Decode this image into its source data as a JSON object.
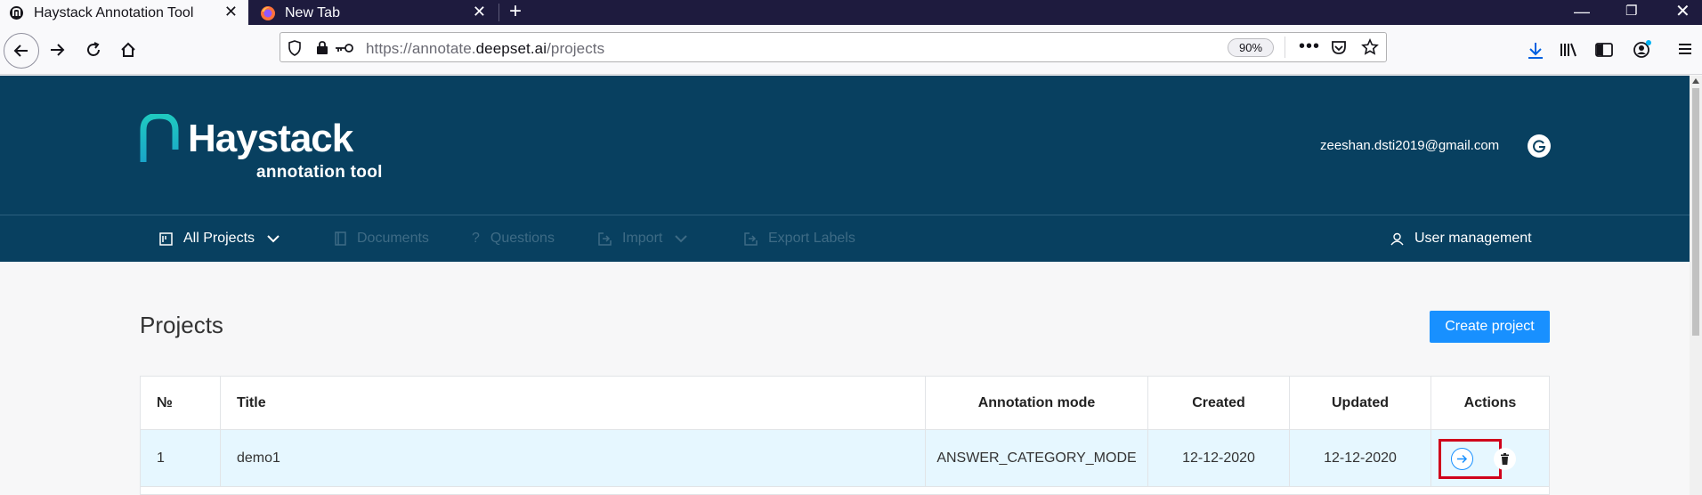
{
  "browser": {
    "tabs": [
      {
        "title": "Haystack Annotation Tool",
        "active": true
      },
      {
        "title": "New Tab",
        "active": false
      }
    ],
    "url_prefix": "https://annotate.",
    "url_host": "deepset.ai",
    "url_path": "/projects",
    "zoom": "90%"
  },
  "header": {
    "logo_text": "Haystack",
    "logo_subtitle": "annotation tool",
    "user_email": "zeeshan.dsti2019@gmail.com"
  },
  "nav": {
    "all_projects": "All Projects",
    "documents": "Documents",
    "questions": "Questions",
    "import": "Import",
    "export_labels": "Export Labels",
    "user_management": "User management"
  },
  "page": {
    "title": "Projects",
    "create_button": "Create project"
  },
  "table": {
    "columns": [
      "№",
      "Title",
      "Annotation mode",
      "Created",
      "Updated",
      "Actions"
    ],
    "rows": [
      {
        "no": "1",
        "title": "demo1",
        "mode": "ANSWER_CATEGORY_MODE",
        "created": "12-12-2020",
        "updated": "12-12-2020"
      }
    ]
  },
  "colors": {
    "header_bg": "#084060",
    "primary": "#1890ff",
    "highlight": "#d0021b"
  }
}
